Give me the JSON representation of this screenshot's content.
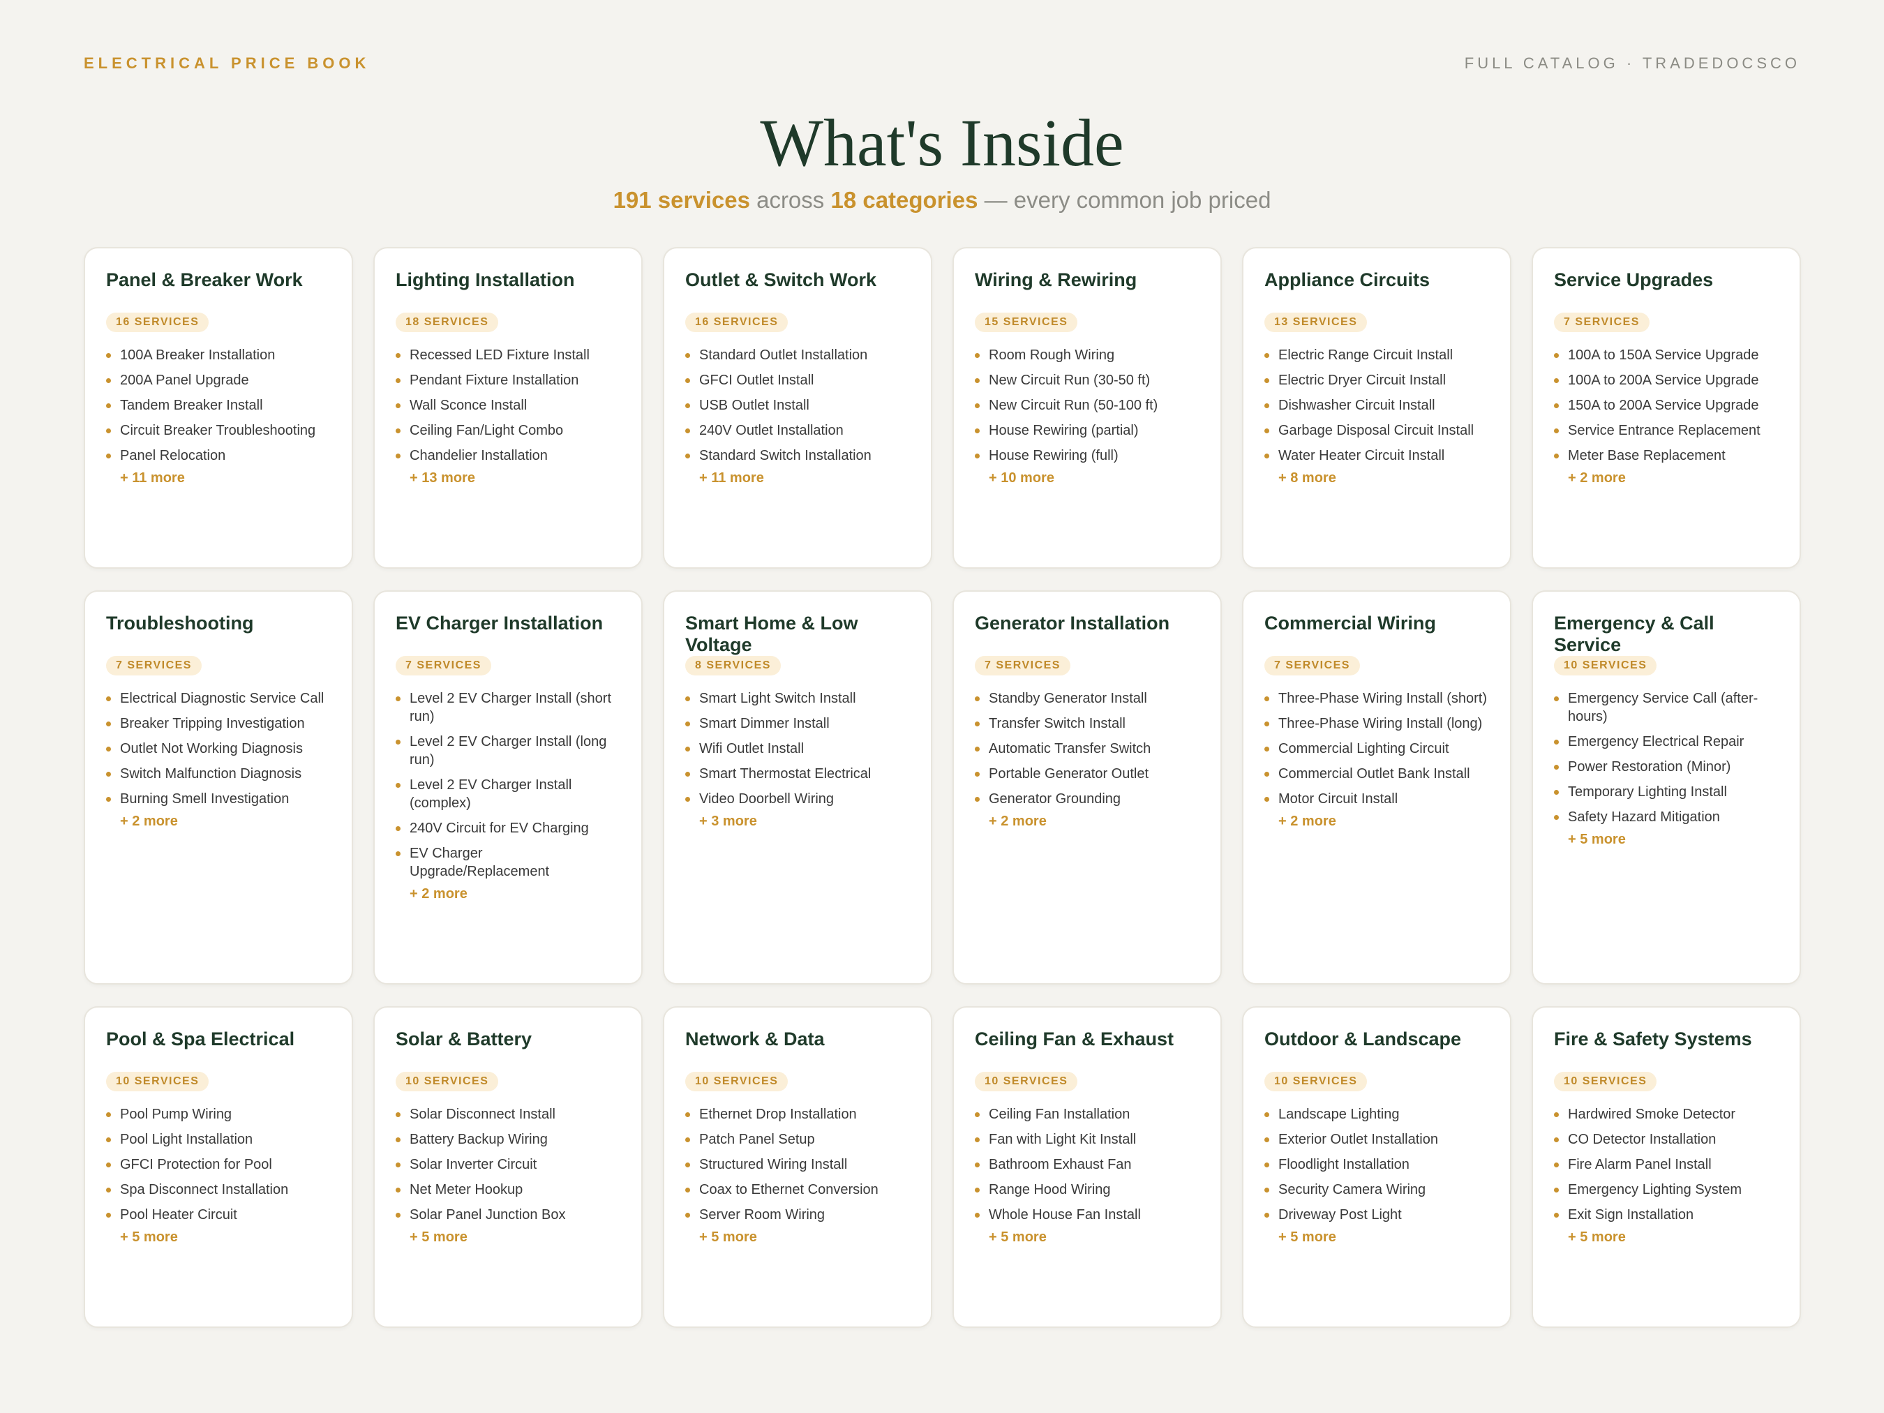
{
  "header": {
    "brand": "ELECTRICAL PRICE BOOK",
    "catalog": "FULL CATALOG · TRADEDOCSCO"
  },
  "hero": {
    "title": "What's Inside",
    "services_count": "191 services",
    "across": " across ",
    "categories_count": "18 categories",
    "tagline": " — every common job priced"
  },
  "colors": {
    "accent": "#c9922e",
    "heading": "#1f3a2a",
    "background": "#f4f3ef",
    "badge_bg": "#fbefd8"
  },
  "categories": [
    {
      "title": "Panel & Breaker Work",
      "badge": "16 SERVICES",
      "items": [
        "100A Breaker Installation",
        "200A Panel Upgrade",
        "Tandem Breaker Install",
        "Circuit Breaker Troubleshooting",
        "Panel Relocation"
      ],
      "more": "+ 11 more"
    },
    {
      "title": "Lighting Installation",
      "badge": "18 SERVICES",
      "items": [
        "Recessed LED Fixture Install",
        "Pendant Fixture Installation",
        "Wall Sconce Install",
        "Ceiling Fan/Light Combo",
        "Chandelier Installation"
      ],
      "more": "+ 13 more"
    },
    {
      "title": "Outlet & Switch Work",
      "badge": "16 SERVICES",
      "items": [
        "Standard Outlet Installation",
        "GFCI Outlet Install",
        "USB Outlet Install",
        "240V Outlet Installation",
        "Standard Switch Installation"
      ],
      "more": "+ 11 more"
    },
    {
      "title": "Wiring & Rewiring",
      "badge": "15 SERVICES",
      "items": [
        "Room Rough Wiring",
        "New Circuit Run (30-50 ft)",
        "New Circuit Run (50-100 ft)",
        "House Rewiring (partial)",
        "House Rewiring (full)"
      ],
      "more": "+ 10 more"
    },
    {
      "title": "Appliance Circuits",
      "badge": "13 SERVICES",
      "items": [
        "Electric Range Circuit Install",
        "Electric Dryer Circuit Install",
        "Dishwasher Circuit Install",
        "Garbage Disposal Circuit Install",
        "Water Heater Circuit Install"
      ],
      "more": "+ 8 more"
    },
    {
      "title": "Service Upgrades",
      "badge": "7 SERVICES",
      "items": [
        "100A to 150A Service Upgrade",
        "100A to 200A Service Upgrade",
        "150A to 200A Service Upgrade",
        "Service Entrance Replacement",
        "Meter Base Replacement"
      ],
      "more": "+ 2 more"
    },
    {
      "title": "Troubleshooting",
      "badge": "7 SERVICES",
      "items": [
        "Electrical Diagnostic Service Call",
        "Breaker Tripping Investigation",
        "Outlet Not Working Diagnosis",
        "Switch Malfunction Diagnosis",
        "Burning Smell Investigation"
      ],
      "more": "+ 2 more"
    },
    {
      "title": "EV Charger Installation",
      "badge": "7 SERVICES",
      "items": [
        "Level 2 EV Charger Install (short run)",
        "Level 2 EV Charger Install (long run)",
        "Level 2 EV Charger Install (complex)",
        "240V Circuit for EV Charging",
        "EV Charger Upgrade/Replacement"
      ],
      "more": "+ 2 more"
    },
    {
      "title": "Smart Home & Low Voltage",
      "badge": "8 SERVICES",
      "items": [
        "Smart Light Switch Install",
        "Smart Dimmer Install",
        "Wifi Outlet Install",
        "Smart Thermostat Electrical",
        "Video Doorbell Wiring"
      ],
      "more": "+ 3 more"
    },
    {
      "title": "Generator Installation",
      "badge": "7 SERVICES",
      "items": [
        "Standby Generator Install",
        "Transfer Switch Install",
        "Automatic Transfer Switch",
        "Portable Generator Outlet",
        "Generator Grounding"
      ],
      "more": "+ 2 more"
    },
    {
      "title": "Commercial Wiring",
      "badge": "7 SERVICES",
      "items": [
        "Three-Phase Wiring Install (short)",
        "Three-Phase Wiring Install (long)",
        "Commercial Lighting Circuit",
        "Commercial Outlet Bank Install",
        "Motor Circuit Install"
      ],
      "more": "+ 2 more"
    },
    {
      "title": "Emergency & Call Service",
      "badge": "10 SERVICES",
      "items": [
        "Emergency Service Call (after-hours)",
        "Emergency Electrical Repair",
        "Power Restoration (Minor)",
        "Temporary Lighting Install",
        "Safety Hazard Mitigation"
      ],
      "more": "+ 5 more"
    },
    {
      "title": "Pool & Spa Electrical",
      "badge": "10 SERVICES",
      "items": [
        "Pool Pump Wiring",
        "Pool Light Installation",
        "GFCI Protection for Pool",
        "Spa Disconnect Installation",
        "Pool Heater Circuit"
      ],
      "more": "+ 5 more"
    },
    {
      "title": "Solar & Battery",
      "badge": "10 SERVICES",
      "items": [
        "Solar Disconnect Install",
        "Battery Backup Wiring",
        "Solar Inverter Circuit",
        "Net Meter Hookup",
        "Solar Panel Junction Box"
      ],
      "more": "+ 5 more"
    },
    {
      "title": "Network & Data",
      "badge": "10 SERVICES",
      "items": [
        "Ethernet Drop Installation",
        "Patch Panel Setup",
        "Structured Wiring Install",
        "Coax to Ethernet Conversion",
        "Server Room Wiring"
      ],
      "more": "+ 5 more"
    },
    {
      "title": "Ceiling Fan & Exhaust",
      "badge": "10 SERVICES",
      "items": [
        "Ceiling Fan Installation",
        "Fan with Light Kit Install",
        "Bathroom Exhaust Fan",
        "Range Hood Wiring",
        "Whole House Fan Install"
      ],
      "more": "+ 5 more"
    },
    {
      "title": "Outdoor & Landscape",
      "badge": "10 SERVICES",
      "items": [
        "Landscape Lighting",
        "Exterior Outlet Installation",
        "Floodlight Installation",
        "Security Camera Wiring",
        "Driveway Post Light"
      ],
      "more": "+ 5 more"
    },
    {
      "title": "Fire & Safety Systems",
      "badge": "10 SERVICES",
      "items": [
        "Hardwired Smoke Detector",
        "CO Detector Installation",
        "Fire Alarm Panel Install",
        "Emergency Lighting System",
        "Exit Sign Installation"
      ],
      "more": "+ 5 more"
    }
  ]
}
